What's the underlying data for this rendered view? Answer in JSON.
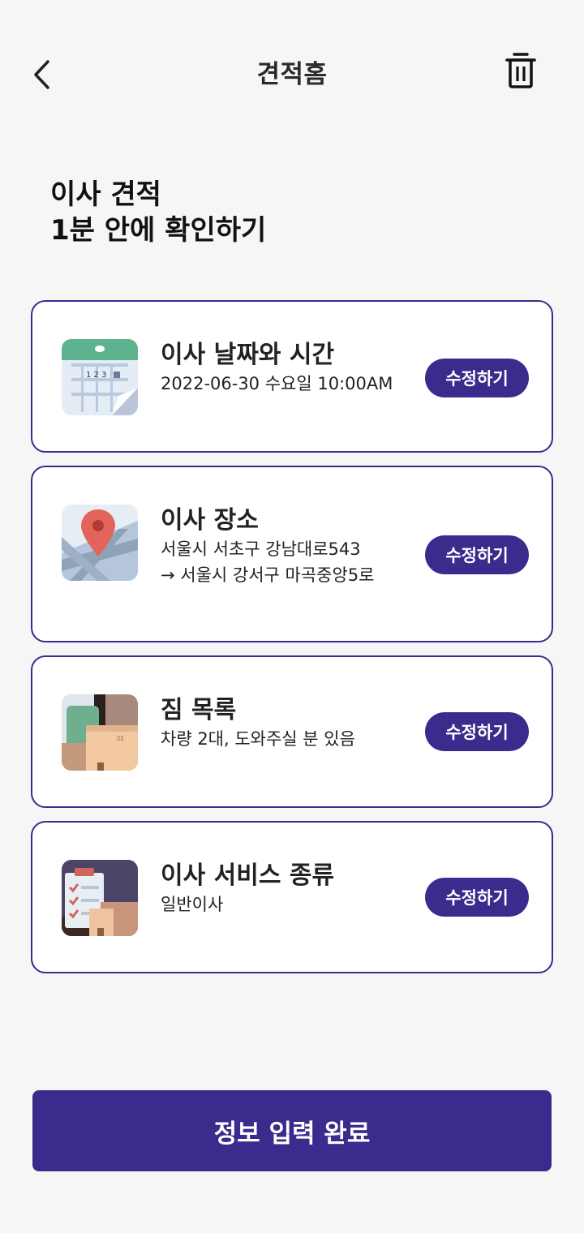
{
  "header": {
    "title": "견적홈",
    "back_icon": "chevron-left-icon",
    "trash_icon": "trash-icon"
  },
  "headline": {
    "line1": "이사 견적",
    "line2": "1분 안에 확인하기"
  },
  "cards": [
    {
      "title": "이사 날짜와 시간",
      "desc": [
        "2022-06-30 수요일 10:00AM"
      ],
      "button": "수정하기",
      "icon": "calendar-icon"
    },
    {
      "title": "이사 장소",
      "desc": [
        "서울시 서초구 강남대로543",
        " → 서울시 강서구 마곡중앙5로"
      ],
      "button": "수정하기",
      "icon": "map-pin-icon"
    },
    {
      "title": "짐 목록",
      "desc": [
        "차량 2대, 도와주실 분 있음"
      ],
      "button": "수정하기",
      "icon": "boxes-icon"
    },
    {
      "title": "이사 서비스 종류",
      "desc": [
        "일반이사"
      ],
      "button": "수정하기",
      "icon": "checklist-icon"
    }
  ],
  "submit": {
    "label": "정보 입력 완료"
  },
  "colors": {
    "accent": "#3b2b8c",
    "background": "#f6f6f6"
  }
}
